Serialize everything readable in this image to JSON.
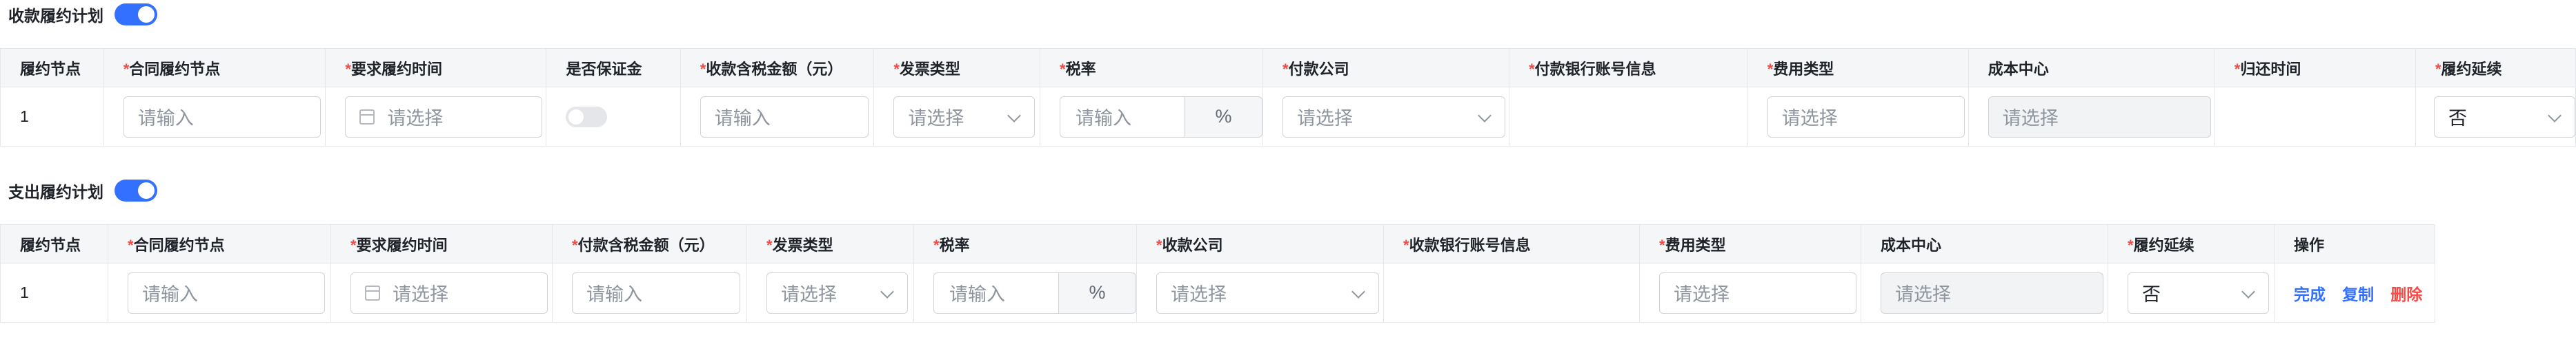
{
  "receipt": {
    "title": "收款履约计划",
    "enabled": true,
    "headers": {
      "node": "履约节点",
      "contract_node": "合同履约节点",
      "required_time": "要求履约时间",
      "is_deposit": "是否保证金",
      "amount": "收款含税金额（元）",
      "invoice_type": "发票类型",
      "tax_rate": "税率",
      "pay_company": "付款公司",
      "bank_info": "付款银行账号信息",
      "expense_type": "费用类型",
      "cost_center": "成本中心",
      "return_time": "归还时间",
      "extension": "履约延续"
    },
    "row": {
      "index": "1",
      "contract_node_placeholder": "请输入",
      "required_time_placeholder": "请选择",
      "deposit_on": false,
      "amount_placeholder": "请输入",
      "invoice_type_placeholder": "请选择",
      "tax_rate_placeholder": "请输入",
      "tax_rate_suffix": "%",
      "pay_company_placeholder": "请选择",
      "expense_type_placeholder": "请选择",
      "cost_center_placeholder": "请选择",
      "extension_value": "否"
    }
  },
  "payment": {
    "title": "支出履约计划",
    "enabled": true,
    "headers": {
      "node": "履约节点",
      "contract_node": "合同履约节点",
      "required_time": "要求履约时间",
      "amount": "付款含税金额（元）",
      "invoice_type": "发票类型",
      "tax_rate": "税率",
      "receive_company": "收款公司",
      "bank_info": "收款银行账号信息",
      "expense_type": "费用类型",
      "cost_center": "成本中心",
      "extension": "履约延续",
      "actions": "操作"
    },
    "row": {
      "index": "1",
      "contract_node_placeholder": "请输入",
      "required_time_placeholder": "请选择",
      "amount_placeholder": "请输入",
      "invoice_type_placeholder": "请选择",
      "tax_rate_placeholder": "请输入",
      "tax_rate_suffix": "%",
      "receive_company_placeholder": "请选择",
      "expense_type_placeholder": "请选择",
      "cost_center_placeholder": "请选择",
      "extension_value": "否",
      "action_done": "完成",
      "action_copy": "复制",
      "action_delete": "删除"
    }
  },
  "colors": {
    "accent": "#3370ff",
    "required": "#f54a45",
    "header_bg": "#f5f6f7"
  }
}
